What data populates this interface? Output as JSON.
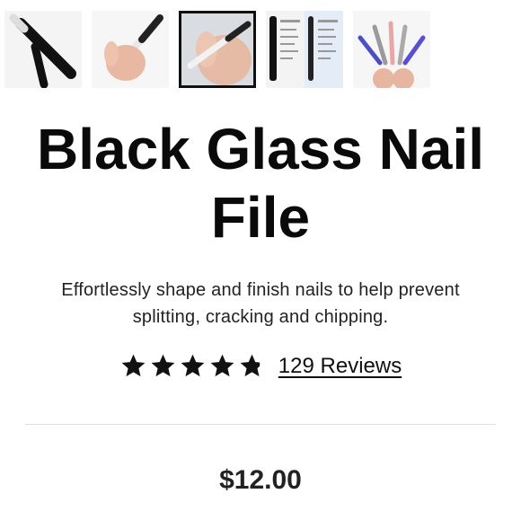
{
  "gallery": {
    "thumbnails": [
      {
        "icon": "nail-file-on-white-image",
        "selected": false
      },
      {
        "icon": "hand-holding-file-image",
        "selected": false
      },
      {
        "icon": "filing-nails-image",
        "selected": true
      },
      {
        "icon": "comparison-chart-image",
        "selected": false
      },
      {
        "icon": "color-variants-image",
        "selected": false
      }
    ]
  },
  "product": {
    "title": "Black Glass Nail File",
    "description": "Effortlessly shape and finish nails to help prevent splitting, cracking and chipping.",
    "rating": {
      "stars": 4.5,
      "max": 5,
      "reviews_label": "129 Reviews"
    },
    "price": "$12.00"
  },
  "colors": {
    "text": "#111111",
    "star": "#111111",
    "divider": "#dedede"
  }
}
